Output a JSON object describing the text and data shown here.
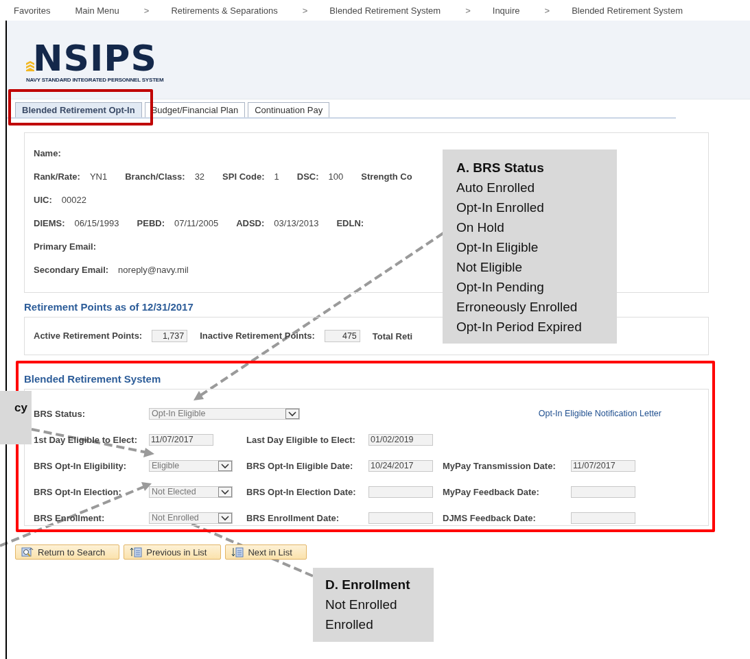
{
  "breadcrumb": [
    {
      "kind": "link",
      "label": "Favorites"
    },
    {
      "kind": "link",
      "label": "Main Menu"
    },
    {
      "kind": "separator",
      "label": ">"
    },
    {
      "kind": "link",
      "label": "Retirements & Separations"
    },
    {
      "kind": "separator",
      "label": ">"
    },
    {
      "kind": "link",
      "label": "Blended Retirement System"
    },
    {
      "kind": "separator",
      "label": ">"
    },
    {
      "kind": "link",
      "label": "Inquire"
    },
    {
      "kind": "separator",
      "label": ">"
    },
    {
      "kind": "link",
      "label": "Blended Retirement System"
    }
  ],
  "logo": {
    "name": "NSIPS",
    "tagline": "NAVY STANDARD INTEGRATED PERSONNEL SYSTEM"
  },
  "tabs": [
    {
      "label": "Blended Retirement Opt-In",
      "selected": true
    },
    {
      "label": "Budget/Financial Plan",
      "selected": false
    },
    {
      "label": "Continuation Pay",
      "selected": false
    }
  ],
  "member_info": {
    "rows": [
      [
        {
          "label": "Name:"
        }
      ],
      [
        {
          "label": "Rank/Rate:",
          "value": "YN1"
        },
        {
          "label": "Branch/Class:",
          "value": "32"
        },
        {
          "label": "SPI Code:",
          "value": "1"
        },
        {
          "label": "DSC:",
          "value": "100"
        },
        {
          "label": "Strength Co"
        }
      ],
      [
        {
          "label": "UIC:",
          "value": "00022"
        }
      ],
      [
        {
          "label": "DIEMS:",
          "value": "06/15/1993"
        },
        {
          "label": "PEBD:",
          "value": "07/11/2005"
        },
        {
          "label": "ADSD:",
          "value": "03/13/2013"
        },
        {
          "label": "EDLN:"
        }
      ],
      [
        {
          "label": "Primary Email:"
        }
      ],
      [
        {
          "label": "Secondary Email:",
          "value": "noreply@navy.mil"
        }
      ]
    ]
  },
  "retirement_points": {
    "heading": "Retirement Points as of 12/31/2017",
    "fields": [
      {
        "label": "Active Retirement Points:",
        "value": "1,737"
      },
      {
        "label": "Inactive Retirement Points:",
        "value": "475"
      },
      {
        "label": "Total Reti"
      }
    ]
  },
  "brs": {
    "heading": "Blended Retirement System",
    "status": {
      "label": "BRS Status:",
      "value": "Opt-In Eligible"
    },
    "link": "Opt-In Eligible Notification Letter",
    "rows": [
      [
        {
          "kind": "text",
          "label": "1st Day Eligible to Elect:",
          "value": "11/07/2017"
        },
        {
          "kind": "text",
          "label": "Last Day Eligible to Elect:",
          "value": "01/02/2019"
        }
      ],
      [
        {
          "kind": "dropdown",
          "label": "BRS Opt-In Eligibility:",
          "value": "Eligible"
        },
        {
          "kind": "text",
          "label": "BRS Opt-In Eligible Date:",
          "value": "10/24/2017"
        },
        {
          "kind": "text",
          "label": "MyPay Transmission Date:",
          "value": "11/07/2017"
        }
      ],
      [
        {
          "kind": "dropdown",
          "label": "BRS Opt-In Election:",
          "value": "Not Elected"
        },
        {
          "kind": "text",
          "label": "BRS Opt-In Election Date:"
        },
        {
          "kind": "text",
          "label": "MyPay Feedback Date:"
        }
      ],
      [
        {
          "kind": "dropdown",
          "label": "BRS Enrollment:",
          "value": "Not Enrolled"
        },
        {
          "kind": "text",
          "label": "BRS Enrollment Date:"
        },
        {
          "kind": "text",
          "label": "DJMS Feedback Date:"
        }
      ]
    ]
  },
  "buttons": [
    {
      "kind": "return",
      "label": "Return to Search"
    },
    {
      "kind": "previous",
      "label": "Previous in List"
    },
    {
      "kind": "next",
      "label": "Next in List"
    }
  ],
  "callouts": [
    {
      "kind": "status",
      "title": "A. BRS Status",
      "lines": [
        "Auto Enrolled",
        "Opt-In Enrolled",
        "On Hold",
        "Opt-In Eligible",
        "Not Eligible",
        "Opt-In Pending",
        "Erroneously Enrolled",
        "Opt-In Period Expired"
      ]
    },
    {
      "kind": "eligibility",
      "title": "cy"
    },
    {
      "kind": "enrollment",
      "title": "D. Enrollment",
      "lines": [
        "Not Enrolled",
        "Enrolled"
      ]
    }
  ]
}
